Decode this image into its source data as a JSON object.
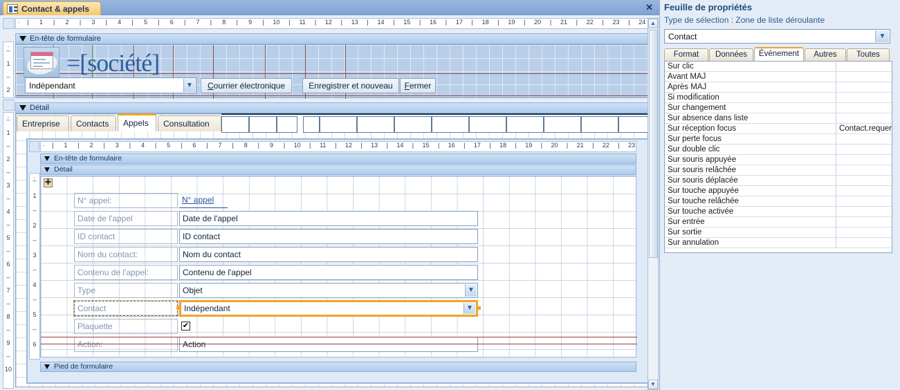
{
  "document_tab": {
    "label": "Contact & appels",
    "icon": "form-design-icon",
    "close_label": "✕"
  },
  "rulers": {
    "top_ticks": [
      "1",
      "2",
      "3",
      "4",
      "5",
      "6",
      "7",
      "8",
      "9",
      "10",
      "11",
      "12",
      "13",
      "14",
      "15",
      "16",
      "17",
      "18",
      "19",
      "20",
      "21",
      "22",
      "23",
      "24"
    ],
    "left_header_ticks": [
      "1",
      "2"
    ],
    "left_detail_ticks": [
      "1",
      "2",
      "3",
      "4",
      "5",
      "6",
      "7",
      "8",
      "9",
      "10"
    ],
    "sub_top_ticks": [
      "1",
      "2",
      "3",
      "4",
      "5",
      "6",
      "7",
      "8",
      "9",
      "10",
      "11",
      "12",
      "13",
      "14",
      "15",
      "16",
      "17",
      "18",
      "19",
      "20",
      "21",
      "22",
      "23"
    ],
    "sub_left_ticks": [
      "1",
      "2",
      "3",
      "4",
      "5",
      "6"
    ]
  },
  "sections": {
    "form_header": "En-tête de formulaire",
    "detail": "Détail",
    "sub_form_header": "En-tête de formulaire",
    "sub_detail": "Détail",
    "sub_form_footer": "Pied de formulaire"
  },
  "header": {
    "logo_name": "company-logo-placeholder",
    "title_expression": "=[société]",
    "combo_value": "Indépendant",
    "buttons": [
      {
        "label": "Courrier électronique",
        "accel": "C"
      },
      {
        "label": "Enregistrer et nouveau",
        "accel": "g"
      },
      {
        "label": "Fermer",
        "accel": "F"
      }
    ]
  },
  "tab_control": {
    "tabs": [
      "Entreprise",
      "Contacts",
      "Appels",
      "Consultation"
    ],
    "active": "Appels"
  },
  "subform": {
    "rows": [
      {
        "label": "N° appel:",
        "control": "N° appel",
        "type": "link",
        "selected": false
      },
      {
        "label": "Date de l'appel",
        "control": "Date de l'appel",
        "type": "text",
        "selected": false
      },
      {
        "label": "ID contact",
        "control": "ID contact",
        "type": "text",
        "selected": false
      },
      {
        "label": "Nom du contact:",
        "control": "Nom du contact",
        "type": "text",
        "selected": false
      },
      {
        "label": "Contenu de l'appel:",
        "control": "Contenu de l'appel",
        "type": "text",
        "selected": false
      },
      {
        "label": "Type",
        "control": "Objet",
        "type": "combo",
        "selected": false
      },
      {
        "label": "Contact",
        "control": "Indépendant",
        "type": "combo",
        "selected": true
      },
      {
        "label": "Plaquette",
        "control": "",
        "type": "checkbox",
        "selected": false
      },
      {
        "label": "Action:",
        "control": "Action",
        "type": "text",
        "selected": false
      }
    ]
  },
  "property_sheet": {
    "title": "Feuille de propriétés",
    "selection_type_label": "Type de sélection :",
    "selection_type_value": "Zone de liste déroulante",
    "object_name": "Contact",
    "tabs": [
      "Format",
      "Données",
      "Événement",
      "Autres",
      "Toutes"
    ],
    "active_tab": "Événement",
    "properties": [
      {
        "name": "Sur clic",
        "value": ""
      },
      {
        "name": "Avant MAJ",
        "value": ""
      },
      {
        "name": "Après MAJ",
        "value": ""
      },
      {
        "name": "Si modification",
        "value": ""
      },
      {
        "name": "Sur changement",
        "value": ""
      },
      {
        "name": "Sur absence dans liste",
        "value": ""
      },
      {
        "name": "Sur réception focus",
        "value": "Contact.requery"
      },
      {
        "name": "Sur perte focus",
        "value": ""
      },
      {
        "name": "Sur double clic",
        "value": ""
      },
      {
        "name": "Sur souris appuyée",
        "value": ""
      },
      {
        "name": "Sur souris relâchée",
        "value": ""
      },
      {
        "name": "Sur souris déplacée",
        "value": ""
      },
      {
        "name": "Sur touche appuyée",
        "value": ""
      },
      {
        "name": "Sur touche relâchée",
        "value": ""
      },
      {
        "name": "Sur touche activée",
        "value": ""
      },
      {
        "name": "Sur entrée",
        "value": ""
      },
      {
        "name": "Sur sortie",
        "value": ""
      },
      {
        "name": "Sur annulation",
        "value": ""
      }
    ]
  },
  "colors": {
    "accent_orange": "#f0a32a",
    "tab_gold": "#f6c66a",
    "title_blue": "#1f4e79",
    "canvas_blue": "#b9cfe9"
  },
  "scrollbar": {
    "up_arrow": "▲",
    "down_arrow": "▼"
  }
}
